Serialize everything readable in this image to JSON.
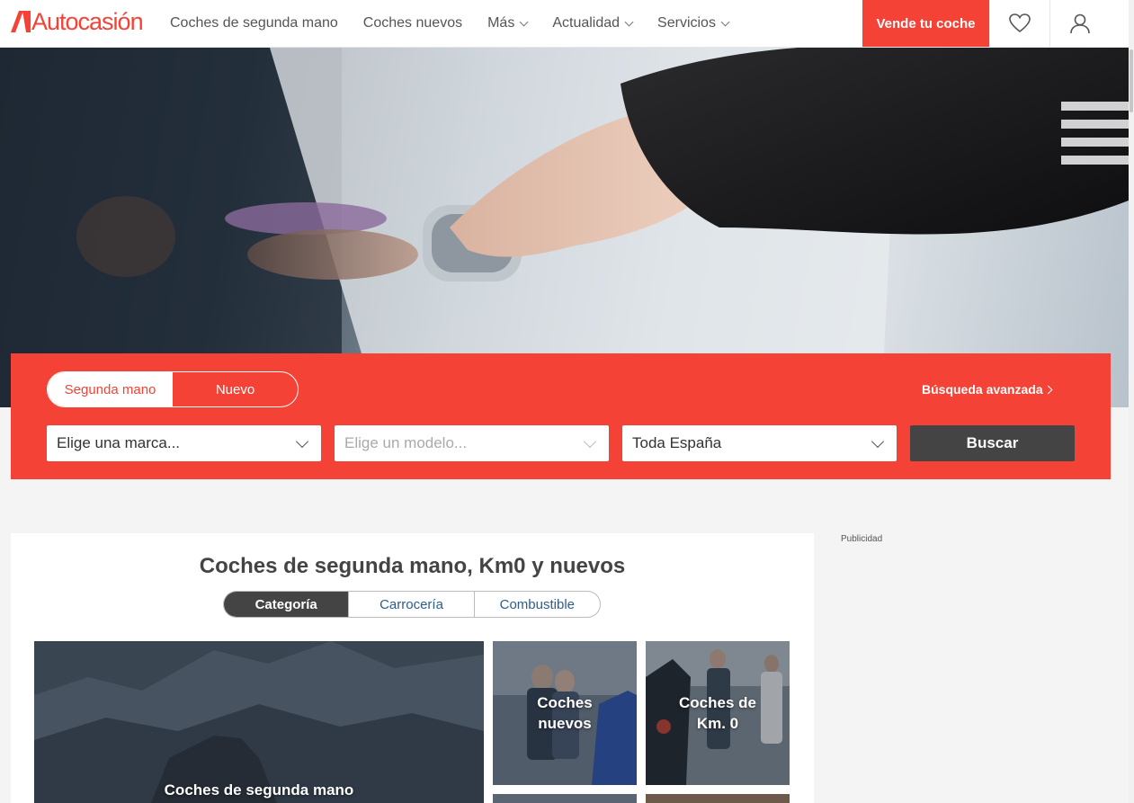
{
  "header": {
    "logo_text": "Autocasión",
    "nav": [
      {
        "label": "Coches de segunda mano",
        "has_dropdown": false
      },
      {
        "label": "Coches nuevos",
        "has_dropdown": false
      },
      {
        "label": "Más",
        "has_dropdown": true
      },
      {
        "label": "Actualidad",
        "has_dropdown": true
      },
      {
        "label": "Servicios",
        "has_dropdown": true
      }
    ],
    "sell_button": "Vende tu coche",
    "favorites_icon": "heart-icon",
    "account_icon": "user-icon"
  },
  "search": {
    "toggle": {
      "used": "Segunda mano",
      "new": "Nuevo",
      "selected": "Segunda mano"
    },
    "advanced_link": "Búsqueda avanzada",
    "brand_placeholder": "Elige una marca...",
    "model_placeholder": "Elige un modelo...",
    "location_value": "Toda España",
    "search_button": "Buscar"
  },
  "main": {
    "title": "Coches de segunda mano, Km0 y nuevos",
    "tabs": [
      {
        "label": "Categoría",
        "active": true
      },
      {
        "label": "Carrocería",
        "active": false
      },
      {
        "label": "Combustible",
        "active": false
      }
    ],
    "tiles": [
      {
        "label": "Coches de segunda mano"
      },
      {
        "label": "Coches nuevos"
      },
      {
        "label": "Coches de Km. 0"
      }
    ]
  },
  "sidebar": {
    "ad_label": "Publicidad"
  },
  "colors": {
    "brand_red": "#f44336",
    "dark_gray": "#444444",
    "link_blue": "#2c5e8d"
  }
}
